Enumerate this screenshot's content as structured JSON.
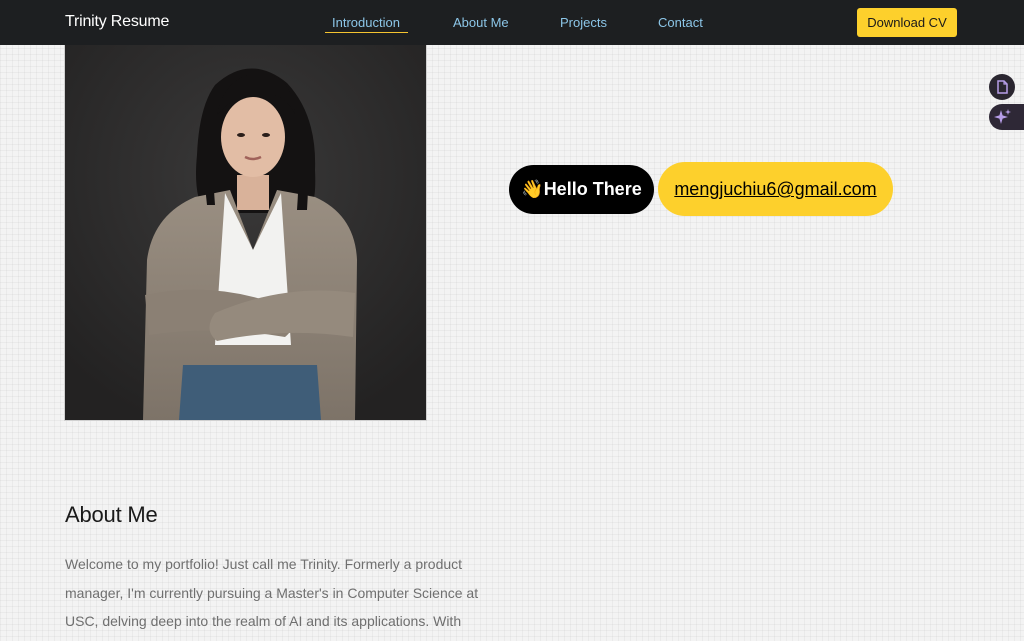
{
  "nav": {
    "brand": "Trinity Resume",
    "links": [
      "Introduction",
      "About Me",
      "Projects",
      "Contact"
    ],
    "active": "Introduction",
    "download_label": "Download CV"
  },
  "hero": {
    "greeting_emoji": "👋",
    "greeting_text": "Hello There",
    "email": "mengjuchiu6@gmail.com"
  },
  "about": {
    "title": "About Me",
    "text": "Welcome to my portfolio! Just call me Trinity. Formerly a product manager, I'm currently pursuing a Master's in Computer Science at USC, delving deep into the realm of AI and its applications. With"
  },
  "side_tools": {
    "icons": [
      "page-icon",
      "sparkle-icon"
    ]
  },
  "colors": {
    "navbar_bg": "#1d1f21",
    "nav_link": "#8cc6e8",
    "accent_yellow": "#fdd02c",
    "page_bg": "#f3f3f3",
    "body_text": "#6f6f6f"
  }
}
